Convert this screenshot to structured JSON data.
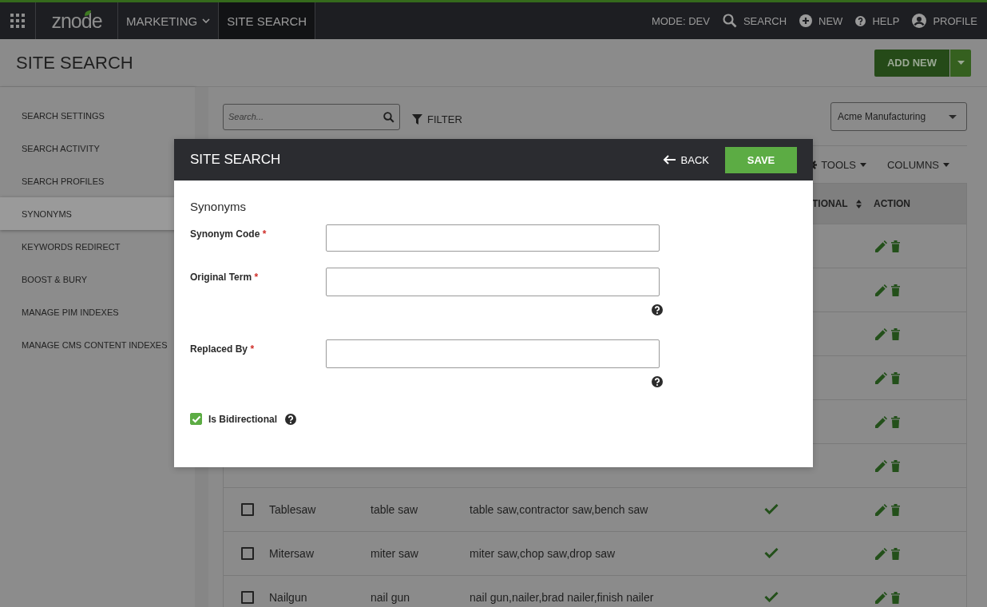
{
  "topbar": {
    "logo": "znode",
    "nav": [
      {
        "label": "MARKETING",
        "dropdown": true,
        "selected": false
      },
      {
        "label": "SITE SEARCH",
        "dropdown": false,
        "selected": true
      }
    ],
    "actions": [
      {
        "kind": "text",
        "label": "MODE: DEV"
      },
      {
        "kind": "search",
        "label": "SEARCH"
      },
      {
        "kind": "new",
        "label": "NEW"
      },
      {
        "kind": "help",
        "label": "HELP"
      },
      {
        "kind": "profile",
        "label": "PROFILE"
      }
    ]
  },
  "page": {
    "title": "SITE SEARCH",
    "add_button": "ADD NEW"
  },
  "sidebar": {
    "items": [
      {
        "label": "SEARCH SETTINGS",
        "selected": false
      },
      {
        "label": "SEARCH ACTIVITY",
        "selected": false
      },
      {
        "label": "SEARCH PROFILES",
        "selected": false
      },
      {
        "label": "SYNONYMS",
        "selected": true
      },
      {
        "label": "KEYWORDS REDIRECT",
        "selected": false
      },
      {
        "label": "BOOST & BURY",
        "selected": false
      },
      {
        "label": "MANAGE PIM INDEXES",
        "selected": false
      },
      {
        "label": "MANAGE CMS CONTENT INDEXES",
        "selected": false
      }
    ]
  },
  "toolbar": {
    "search": {
      "placeholder": "Search..."
    },
    "filter": "FILTER",
    "store": "Acme Manufacturing",
    "tools": "TOOLS",
    "columns": "COLUMNS"
  },
  "table": {
    "columns": [
      "TIONAL",
      "ACTION"
    ],
    "rows": [
      {},
      {},
      {},
      {},
      {},
      {},
      {
        "checked": false,
        "code": "Tablesaw",
        "term": "table saw",
        "replaced_by": "table saw,contractor saw,bench saw",
        "bidirectional": true
      },
      {
        "checked": false,
        "code": "Mitersaw",
        "term": "miter saw",
        "replaced_by": "miter saw,chop saw,drop saw",
        "bidirectional": true
      },
      {
        "checked": false,
        "code": "Nailgun",
        "term": "nail gun",
        "replaced_by": "nail gun,nailer,brad nailer,finish nailer",
        "bidirectional": true
      }
    ]
  },
  "modal": {
    "title": "SITE SEARCH",
    "back": "BACK",
    "save": "SAVE",
    "section": "Synonyms",
    "fields": [
      {
        "label": "Synonym Code",
        "required_mark": "*",
        "help": false
      },
      {
        "label": "Original Term",
        "required_mark": "*",
        "help": true
      },
      {
        "label": "Replaced By",
        "required_mark": "*",
        "help": true
      }
    ],
    "checkbox": {
      "label": "Is Bidirectional",
      "checked": true,
      "help": true
    }
  }
}
